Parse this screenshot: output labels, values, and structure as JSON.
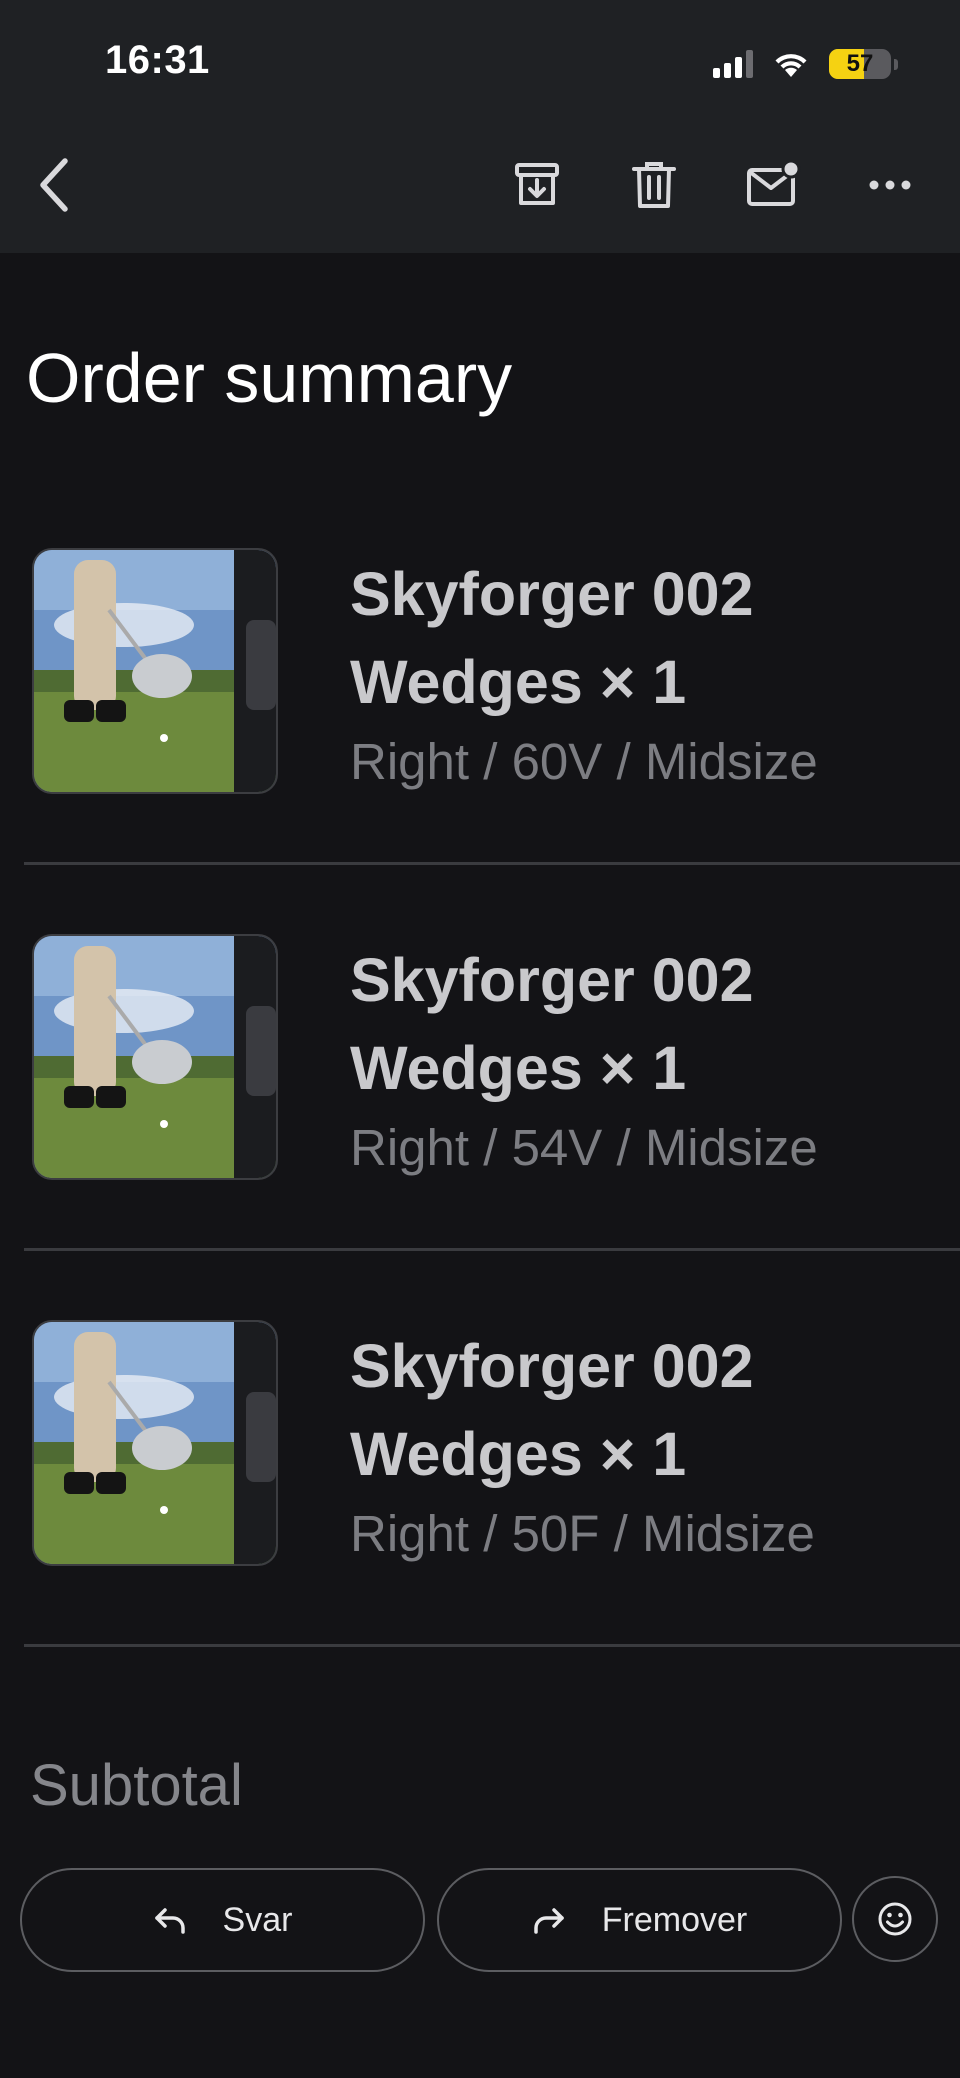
{
  "status_bar": {
    "time": "16:31",
    "battery": "57",
    "battery_level": 0.57
  },
  "toolbar": {
    "icons": [
      "back-arrow-icon",
      "archive-icon",
      "trash-icon",
      "mark-unread-icon",
      "more-icon"
    ]
  },
  "main": {
    "title": "Order summary",
    "items": [
      {
        "name": "Skyforger 002 Wedges × 1",
        "variant": "Right / 60V / Midsize",
        "image": "golfer-wedge-photo"
      },
      {
        "name": "Skyforger 002 Wedges × 1",
        "variant": "Right / 54V / Midsize",
        "image": "golfer-wedge-photo"
      },
      {
        "name": "Skyforger 002 Wedges × 1",
        "variant": "Right / 50F / Midsize",
        "image": "golfer-wedge-photo"
      }
    ],
    "subtotal_label": "Subtotal"
  },
  "actions": {
    "reply_label": "Svar",
    "forward_label": "Fremover",
    "reply_icon": "reply-arrow-icon",
    "forward_icon": "forward-arrow-icon",
    "emoji_icon": "emoji-react-icon"
  },
  "colors": {
    "background": "#131316",
    "topbar": "#1f2124",
    "battery_accent": "#f5d212"
  }
}
